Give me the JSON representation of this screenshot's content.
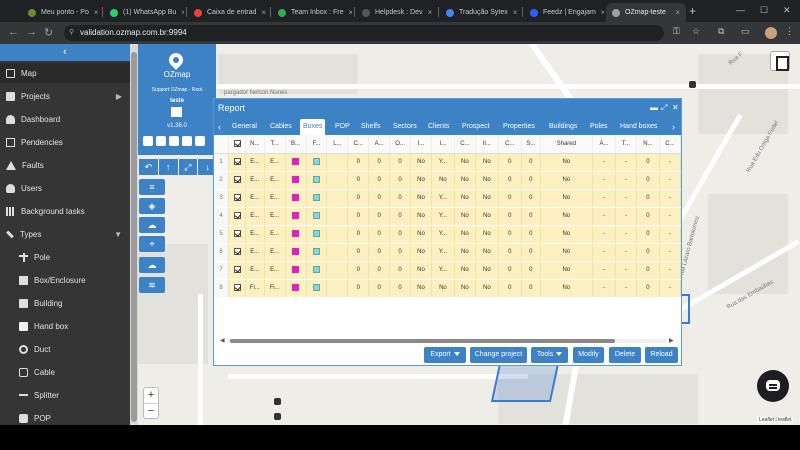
{
  "browser": {
    "tabs": [
      {
        "title": "Meu ponto - Po",
        "color": "#6b8e23"
      },
      {
        "title": "(1) WhatsApp Bu",
        "color": "#25d366"
      },
      {
        "title": "Caixa de entrad",
        "color": "#ea4335"
      },
      {
        "title": "Team Inbox : Fre",
        "color": "#34a853"
      },
      {
        "title": "Helpdesk : Dev",
        "color": "#555555"
      },
      {
        "title": "Tradução Sytex",
        "color": "#4285f4"
      },
      {
        "title": "Feedz | Engajam",
        "color": "#2962ff"
      },
      {
        "title": "OZmap-teste",
        "color": "#9aa0a6"
      }
    ],
    "active_tab": "OZmap-teste",
    "url": "validation.ozmap.com.br:9994"
  },
  "sidebar": {
    "collapse_label": "‹",
    "items": [
      {
        "label": "Map",
        "icon": "map-icon"
      },
      {
        "label": "Projects",
        "icon": "projects-icon"
      },
      {
        "label": "Dashboard",
        "icon": "dashboard-icon"
      },
      {
        "label": "Pendencies",
        "icon": "pendencies-icon"
      },
      {
        "label": "Faults",
        "icon": "faults-icon"
      },
      {
        "label": "Users",
        "icon": "users-icon"
      },
      {
        "label": "Background tasks",
        "icon": "background-tasks-icon"
      },
      {
        "label": "Types",
        "icon": "types-icon"
      },
      {
        "label": "Pole",
        "icon": "pole-icon"
      },
      {
        "label": "Box/Enclosure",
        "icon": "box-icon"
      },
      {
        "label": "Building",
        "icon": "building-icon"
      },
      {
        "label": "Hand box",
        "icon": "hand-box-icon"
      },
      {
        "label": "Duct",
        "icon": "duct-icon"
      },
      {
        "label": "Cable",
        "icon": "cable-icon"
      },
      {
        "label": "Splitter",
        "icon": "splitter-icon"
      },
      {
        "label": "POP",
        "icon": "pop-icon"
      }
    ]
  },
  "ozpanel": {
    "title": "OZmap",
    "subtitle": "Support OZmap - Root",
    "user": "teste",
    "version": "v1.36.0"
  },
  "map": {
    "street_labels": [
      "Rua Edu Ortiga Fedel",
      "Rua das Embaúbas",
      "Rua Lázaro Bartolomeu",
      "pargador Nelson Nunes",
      "Rua F"
    ],
    "zoom_in": "+",
    "zoom_out": "−",
    "attribution": "Leaflet | leaflet"
  },
  "report": {
    "title": "Report",
    "tabs": [
      "General",
      "Cables",
      "Boxes",
      "POP",
      "Shelfs",
      "Sectors",
      "Clients",
      "Prospect",
      "Properties",
      "Buildings",
      "Poles",
      "Hand boxes"
    ],
    "active_tab": "Boxes",
    "columns": [
      "",
      "",
      "N...",
      "T...",
      "B...",
      "F...",
      "L...",
      "C...",
      "A...",
      "O...",
      "I...",
      "I...",
      "C...",
      "Il...",
      "C...",
      "S...",
      "Shared",
      "A...",
      "T...",
      "N...",
      "C..."
    ],
    "rows": [
      {
        "num": "1",
        "name": "E...",
        "type": "E...",
        "b": "#e020c0",
        "f": "#8fd3d6",
        "c": "0",
        "a": "0",
        "o": "0",
        "i1": "No",
        "i2": "Y...",
        "c2": "No",
        "il": "No",
        "c3": "0",
        "s": "0",
        "shared": "No",
        "a2": "-",
        "t": "-",
        "n": "0",
        "c4": "-"
      },
      {
        "num": "2",
        "name": "E...",
        "type": "E...",
        "b": "#e020c0",
        "f": "#8fd3d6",
        "c": "0",
        "a": "0",
        "o": "0",
        "i1": "No",
        "i2": "No",
        "c2": "No",
        "il": "No",
        "c3": "0",
        "s": "0",
        "shared": "No",
        "a2": "-",
        "t": "-",
        "n": "0",
        "c4": "-"
      },
      {
        "num": "3",
        "name": "E...",
        "type": "E...",
        "b": "#e020c0",
        "f": "#8fd3d6",
        "c": "0",
        "a": "0",
        "o": "0",
        "i1": "No",
        "i2": "Y...",
        "c2": "No",
        "il": "No",
        "c3": "0",
        "s": "0",
        "shared": "No",
        "a2": "-",
        "t": "-",
        "n": "0",
        "c4": "-"
      },
      {
        "num": "4",
        "name": "E...",
        "type": "E...",
        "b": "#e020c0",
        "f": "#8fd3d6",
        "c": "0",
        "a": "0",
        "o": "0",
        "i1": "No",
        "i2": "Y...",
        "c2": "No",
        "il": "No",
        "c3": "0",
        "s": "0",
        "shared": "No",
        "a2": "-",
        "t": "-",
        "n": "0",
        "c4": "-"
      },
      {
        "num": "5",
        "name": "E...",
        "type": "E...",
        "b": "#e020c0",
        "f": "#8fd3d6",
        "c": "0",
        "a": "0",
        "o": "0",
        "i1": "No",
        "i2": "Y...",
        "c2": "No",
        "il": "No",
        "c3": "0",
        "s": "0",
        "shared": "No",
        "a2": "-",
        "t": "-",
        "n": "0",
        "c4": "-"
      },
      {
        "num": "6",
        "name": "E...",
        "type": "E...",
        "b": "#e020c0",
        "f": "#8fd3d6",
        "c": "0",
        "a": "0",
        "o": "0",
        "i1": "No",
        "i2": "Y...",
        "c2": "No",
        "il": "No",
        "c3": "0",
        "s": "0",
        "shared": "No",
        "a2": "-",
        "t": "-",
        "n": "0",
        "c4": "-"
      },
      {
        "num": "7",
        "name": "E...",
        "type": "E...",
        "b": "#e020c0",
        "f": "#8fd3d6",
        "c": "0",
        "a": "0",
        "o": "0",
        "i1": "No",
        "i2": "Y...",
        "c2": "No",
        "il": "No",
        "c3": "0",
        "s": "0",
        "shared": "No",
        "a2": "-",
        "t": "-",
        "n": "0",
        "c4": "-"
      },
      {
        "num": "8",
        "name": "Fi...",
        "type": "Fi...",
        "b": "#e020c0",
        "f": "#8fd3d6",
        "c": "0",
        "a": "0",
        "o": "0",
        "i1": "No",
        "i2": "No",
        "c2": "No",
        "il": "No",
        "c3": "0",
        "s": "0",
        "shared": "No",
        "a2": "-",
        "t": "-",
        "n": "0",
        "c4": "-"
      }
    ],
    "footer_buttons": {
      "export": "Export",
      "change_project": "Change project",
      "tools": "Tools",
      "modify": "Modify",
      "delete": "Delete",
      "reload": "Reload"
    }
  },
  "colors": {
    "accent": "#3d82c4",
    "sidebar_bg": "#353535",
    "row_bg": "#fcefc0",
    "polygon": "#3a7bd5"
  }
}
